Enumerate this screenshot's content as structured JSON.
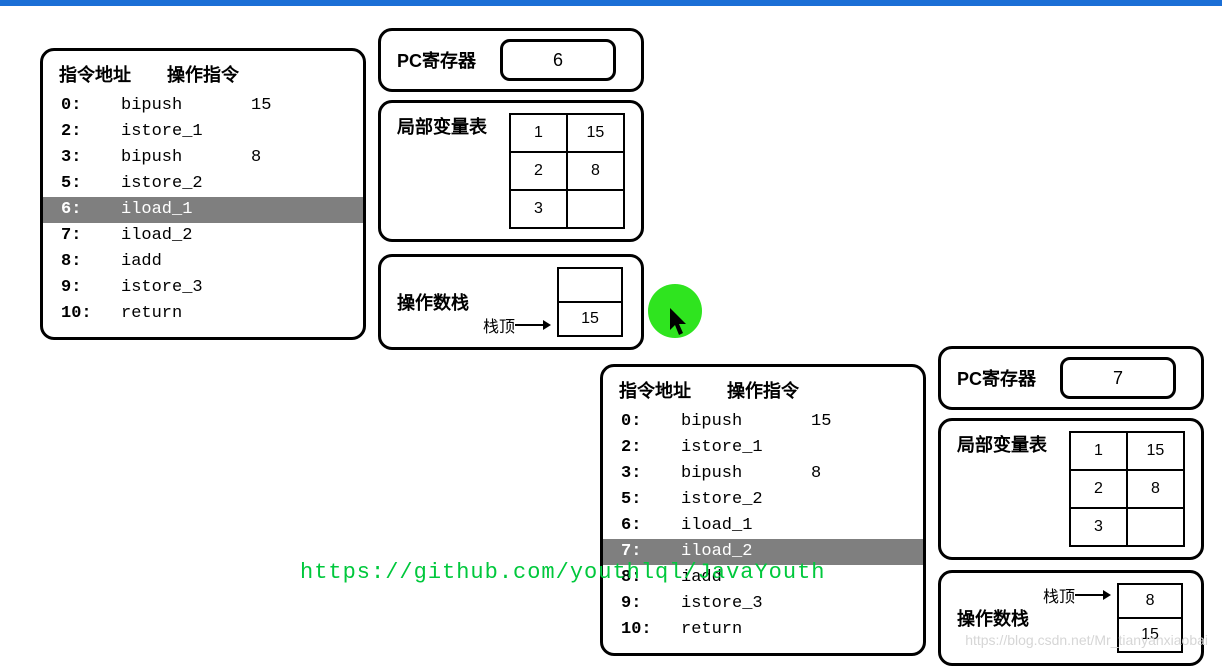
{
  "topbar_color": "#1b6fd6",
  "overlay_url": "https://github.com/youthlql/JavaYouth",
  "csdn_watermark": "https://blog.csdn.net/Mr_tianyanxiaobai",
  "instr1": {
    "header_addr": "指令地址",
    "header_op": "操作指令",
    "highlight_index": 4,
    "rows": [
      {
        "addr": "0:",
        "op": "bipush",
        "arg": "15"
      },
      {
        "addr": "2:",
        "op": "istore_1",
        "arg": ""
      },
      {
        "addr": "3:",
        "op": "bipush",
        "arg": "8"
      },
      {
        "addr": "5:",
        "op": "istore_2",
        "arg": ""
      },
      {
        "addr": "6:",
        "op": "iload_1",
        "arg": ""
      },
      {
        "addr": "7:",
        "op": "iload_2",
        "arg": ""
      },
      {
        "addr": "8:",
        "op": "iadd",
        "arg": ""
      },
      {
        "addr": "9:",
        "op": "istore_3",
        "arg": ""
      },
      {
        "addr": "10:",
        "op": "return",
        "arg": ""
      }
    ]
  },
  "pc1": {
    "label": "PC寄存器",
    "value": "6"
  },
  "lvt1": {
    "label": "局部变量表",
    "cells": [
      [
        "1",
        "15"
      ],
      [
        "2",
        "8"
      ],
      [
        "3",
        ""
      ]
    ]
  },
  "ops1": {
    "label": "操作数栈",
    "top_label": "栈顶",
    "cells": [
      "",
      "15"
    ]
  },
  "instr2": {
    "header_addr": "指令地址",
    "header_op": "操作指令",
    "highlight_index": 5,
    "rows": [
      {
        "addr": "0:",
        "op": "bipush",
        "arg": "15"
      },
      {
        "addr": "2:",
        "op": "istore_1",
        "arg": ""
      },
      {
        "addr": "3:",
        "op": "bipush",
        "arg": "8"
      },
      {
        "addr": "5:",
        "op": "istore_2",
        "arg": ""
      },
      {
        "addr": "6:",
        "op": "iload_1",
        "arg": ""
      },
      {
        "addr": "7:",
        "op": "iload_2",
        "arg": ""
      },
      {
        "addr": "8:",
        "op": "iadd",
        "arg": ""
      },
      {
        "addr": "9:",
        "op": "istore_3",
        "arg": ""
      },
      {
        "addr": "10:",
        "op": "return",
        "arg": ""
      }
    ]
  },
  "pc2": {
    "label": "PC寄存器",
    "value": "7"
  },
  "lvt2": {
    "label": "局部变量表",
    "cells": [
      [
        "1",
        "15"
      ],
      [
        "2",
        "8"
      ],
      [
        "3",
        ""
      ]
    ]
  },
  "ops2": {
    "label": "操作数栈",
    "top_label": "栈顶",
    "cells": [
      "8",
      "15"
    ]
  }
}
